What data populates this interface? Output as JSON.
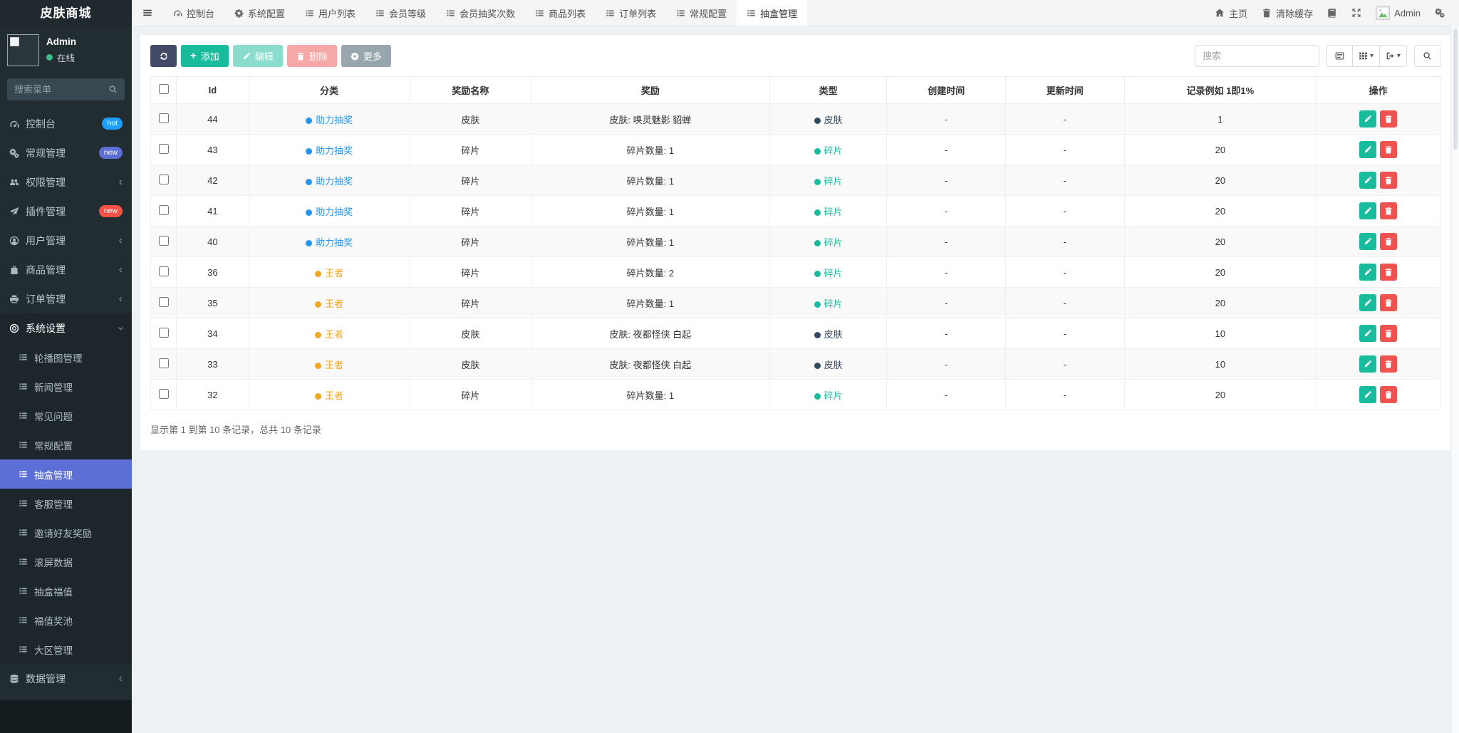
{
  "brand": {
    "title": "皮肤商城"
  },
  "user": {
    "name": "Admin",
    "status_label": "在线",
    "status_color": "#3dbb85"
  },
  "sidebar": {
    "search_placeholder": "搜索菜单",
    "items": [
      {
        "label": "控制台",
        "icon": "dashboard-icon",
        "badge": {
          "text": "hot",
          "color": "#1e9fff"
        }
      },
      {
        "label": "常规管理",
        "icon": "cogs-icon",
        "badge": {
          "text": "new",
          "color": "#5c6fd6"
        }
      },
      {
        "label": "权限管理",
        "icon": "users-icon",
        "chevron": "left"
      },
      {
        "label": "插件管理",
        "icon": "paper-plane-icon",
        "badge": {
          "text": "new",
          "color": "#f55145"
        }
      },
      {
        "label": "用户管理",
        "icon": "user-circle-icon",
        "chevron": "left"
      },
      {
        "label": "商品管理",
        "icon": "shopping-bag-icon",
        "chevron": "left"
      },
      {
        "label": "订单管理",
        "icon": "printer-icon",
        "chevron": "left"
      },
      {
        "label": "系统设置",
        "icon": "settings-icon",
        "chevron": "down",
        "expanded": true,
        "children": [
          {
            "label": "轮播图管理"
          },
          {
            "label": "新闻管理"
          },
          {
            "label": "常见问题"
          },
          {
            "label": "常规配置"
          },
          {
            "label": "抽盒管理",
            "active": true
          },
          {
            "label": "客服管理"
          },
          {
            "label": "邀请好友奖励"
          },
          {
            "label": "滚屏数据"
          },
          {
            "label": "抽盒福值"
          },
          {
            "label": "福值奖池"
          },
          {
            "label": "大区管理"
          }
        ]
      },
      {
        "label": "数据管理",
        "icon": "database-icon",
        "chevron": "left"
      }
    ]
  },
  "topnav": {
    "tabs": [
      {
        "label": "控制台",
        "icon": "dashboard-icon"
      },
      {
        "label": "系统配置",
        "icon": "gear-icon"
      },
      {
        "label": "用户列表",
        "icon": "list-icon"
      },
      {
        "label": "会员等级",
        "icon": "list-icon"
      },
      {
        "label": "会员抽奖次数",
        "icon": "list-icon"
      },
      {
        "label": "商品列表",
        "icon": "list-icon"
      },
      {
        "label": "订单列表",
        "icon": "list-icon"
      },
      {
        "label": "常规配置",
        "icon": "list-icon"
      },
      {
        "label": "抽盒管理",
        "icon": "list-icon",
        "active": true
      }
    ],
    "right": {
      "home_label": "主页",
      "clear_cache_label": "清除缓存",
      "tool_icons": [
        "doc-icon",
        "fullscreen-icon"
      ],
      "username": "Admin",
      "settings_icon": "cogs-icon"
    }
  },
  "toolbar": {
    "add_label": "添加",
    "edit_label": "编辑",
    "delete_label": "删除",
    "more_label": "更多",
    "search_placeholder": "搜索"
  },
  "table": {
    "headers": [
      "Id",
      "分类",
      "奖励名称",
      "奖励",
      "类型",
      "创建时间",
      "更新时间",
      "记录例如 1即1%",
      "操作"
    ],
    "category_colors": {
      "助力抽奖": "#2196f3",
      "王者": "#f5a623"
    },
    "type_colors": {
      "皮肤": "#34495e",
      "碎片": "#18bc9c"
    },
    "rows": [
      {
        "id": "44",
        "category": "助力抽奖",
        "reward_name": "皮肤",
        "reward": "皮肤: 唤灵魅影 貂蝉",
        "type": "皮肤",
        "created": "-",
        "updated": "-",
        "record": "1"
      },
      {
        "id": "43",
        "category": "助力抽奖",
        "reward_name": "碎片",
        "reward": "碎片数量: 1",
        "type": "碎片",
        "created": "-",
        "updated": "-",
        "record": "20"
      },
      {
        "id": "42",
        "category": "助力抽奖",
        "reward_name": "碎片",
        "reward": "碎片数量: 1",
        "type": "碎片",
        "created": "-",
        "updated": "-",
        "record": "20"
      },
      {
        "id": "41",
        "category": "助力抽奖",
        "reward_name": "碎片",
        "reward": "碎片数量: 1",
        "type": "碎片",
        "created": "-",
        "updated": "-",
        "record": "20"
      },
      {
        "id": "40",
        "category": "助力抽奖",
        "reward_name": "碎片",
        "reward": "碎片数量: 1",
        "type": "碎片",
        "created": "-",
        "updated": "-",
        "record": "20"
      },
      {
        "id": "36",
        "category": "王者",
        "reward_name": "碎片",
        "reward": "碎片数量: 2",
        "type": "碎片",
        "created": "-",
        "updated": "-",
        "record": "20"
      },
      {
        "id": "35",
        "category": "王者",
        "reward_name": "碎片",
        "reward": "碎片数量: 1",
        "type": "碎片",
        "created": "-",
        "updated": "-",
        "record": "20"
      },
      {
        "id": "34",
        "category": "王者",
        "reward_name": "皮肤",
        "reward": "皮肤: 夜都怪侠 白起",
        "type": "皮肤",
        "created": "-",
        "updated": "-",
        "record": "10"
      },
      {
        "id": "33",
        "category": "王者",
        "reward_name": "皮肤",
        "reward": "皮肤: 夜都怪侠 白起",
        "type": "皮肤",
        "created": "-",
        "updated": "-",
        "record": "10"
      },
      {
        "id": "32",
        "category": "王者",
        "reward_name": "碎片",
        "reward": "碎片数量: 1",
        "type": "碎片",
        "created": "-",
        "updated": "-",
        "record": "20"
      }
    ],
    "col_widths": [
      "2%",
      "5.6%",
      "12.5%",
      "9.4%",
      "18.5%",
      "9.1%",
      "9.2%",
      "9.2%",
      "14.9%",
      "9.6%"
    ],
    "summary": "显示第 1 到第 10 条记录，总共 10 条记录"
  }
}
